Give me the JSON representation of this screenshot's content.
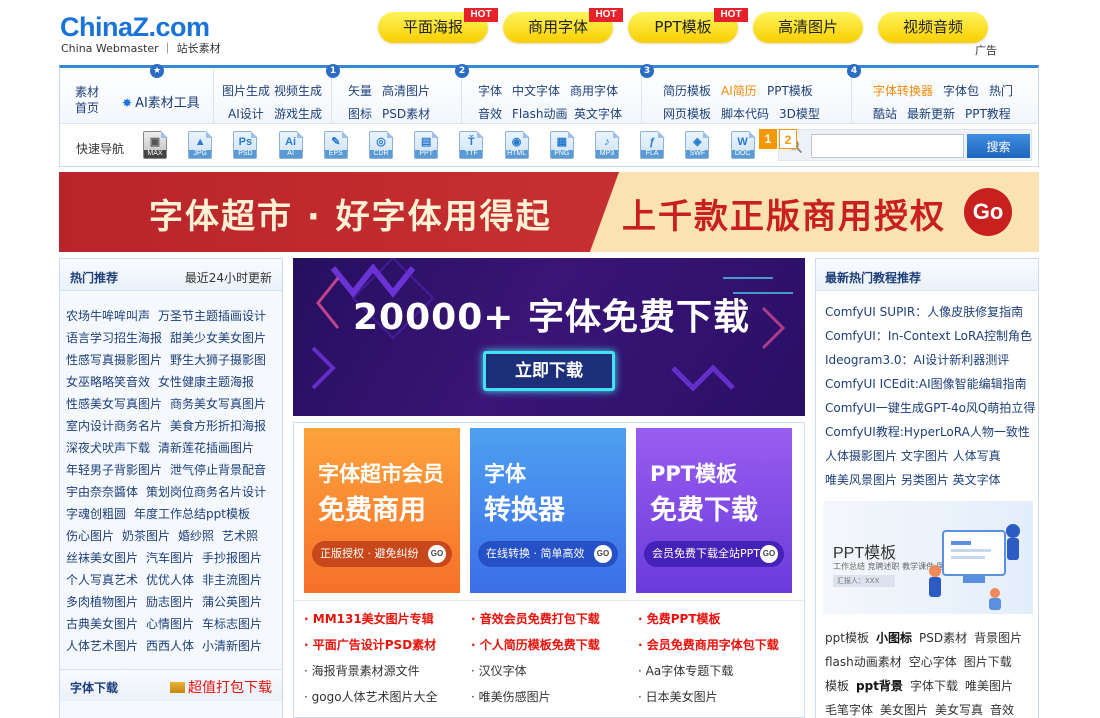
{
  "header": {
    "logo_main": "ChinaZ.com",
    "logo_sub": "China Webmaster ｜ 站长素材",
    "top_buttons": [
      {
        "label": "平面海报",
        "hot": "HOT"
      },
      {
        "label": "商用字体",
        "hot": "HOT"
      },
      {
        "label": "PPT模板",
        "hot": "HOT"
      },
      {
        "label": "高清图片",
        "hot": ""
      },
      {
        "label": "视频音频",
        "hot": ""
      }
    ],
    "ad_label": "广告"
  },
  "nav": {
    "home": "素材首页",
    "ai_tool": "AI素材工具",
    "badges": [
      "1",
      "2",
      "3",
      "4"
    ],
    "group1": [
      "图片生成",
      "视频生成",
      "AI设计",
      "游戏生成"
    ],
    "group2": [
      "矢量",
      "高清图片",
      "图标",
      "PSD素材"
    ],
    "group3": [
      "字体",
      "中文字体",
      "商用字体",
      "音效",
      "Flash动画",
      "英文字体"
    ],
    "group4": [
      "简历模板",
      "AI简历",
      "PPT模板",
      "网页模板",
      "脚本代码",
      "3D模型"
    ],
    "group5": [
      "字体转换器",
      "字体包",
      "热门",
      "酷站",
      "最新更新",
      "PPT教程"
    ],
    "quick_label": "快速导航",
    "file_icons": [
      {
        "glyph": "▣",
        "ext": "MAX",
        "icon": "max-file-icon"
      },
      {
        "glyph": "▲",
        "ext": "JPG",
        "icon": "jpg-file-icon"
      },
      {
        "glyph": "Ps",
        "ext": "PSD",
        "icon": "psd-file-icon"
      },
      {
        "glyph": "Ai",
        "ext": "AI",
        "icon": "ai-file-icon"
      },
      {
        "glyph": "✎",
        "ext": "EPS",
        "icon": "eps-file-icon"
      },
      {
        "glyph": "◎",
        "ext": "CDR",
        "icon": "cdr-file-icon"
      },
      {
        "glyph": "▤",
        "ext": "PPT",
        "icon": "ppt-file-icon"
      },
      {
        "glyph": "Ť",
        "ext": "TTF",
        "icon": "ttf-file-icon"
      },
      {
        "glyph": "◉",
        "ext": "HTML",
        "icon": "html-file-icon"
      },
      {
        "glyph": "▦",
        "ext": "PNG",
        "icon": "png-file-icon"
      },
      {
        "glyph": "♪",
        "ext": "MP3",
        "icon": "mp3-file-icon"
      },
      {
        "glyph": "ƒ",
        "ext": "FLA",
        "icon": "fla-file-icon"
      },
      {
        "glyph": "◈",
        "ext": "SWF",
        "icon": "swf-file-icon"
      },
      {
        "glyph": "W",
        "ext": "DOC",
        "icon": "doc-file-icon"
      }
    ],
    "search_value": "",
    "search_button": "搜索"
  },
  "banner": {
    "left_text": "字体超市 · 好字体用得起",
    "right_text": "上千款正版商用授权",
    "go": "Go"
  },
  "left_sidebar": {
    "title": "热门推荐",
    "note": "最近24小时更新",
    "rows": [
      [
        "农场牛哞哞叫声",
        "万圣节主题插画设计"
      ],
      [
        "语言学习招生海报",
        "甜美少女美女图片"
      ],
      [
        "性感写真摄影图片",
        "野生大狮子摄影图"
      ],
      [
        "女巫略略笑音效",
        "女性健康主题海报"
      ],
      [
        "性感美女写真图片",
        "商务美女写真图片"
      ],
      [
        "室内设计商务名片",
        "美食方形折扣海报"
      ],
      [
        "深夜犬吠声下载",
        "清新莲花插画图片"
      ],
      [
        "年轻男子背影图片",
        "泄气停止背景配音"
      ],
      [
        "宇由奈奈醬体",
        "策划岗位商务名片设计"
      ],
      [
        "字魂创粗圆",
        "年度工作总结ppt模板"
      ],
      [
        "伤心图片",
        "奶茶图片",
        "婚纱照",
        "艺术照"
      ],
      [
        "丝袜美女图片",
        "汽车图片",
        "手抄报图片"
      ],
      [
        "个人写真艺术",
        "优优人体",
        "非主流图片"
      ],
      [
        "多肉植物图片",
        "励志图片",
        "蒲公英图片"
      ],
      [
        "古典美女图片",
        "心情图片",
        "车标志图片"
      ],
      [
        "人体艺术图片",
        "西西人体",
        "小清新图片"
      ]
    ],
    "font_download_title": "字体下载",
    "font_download_link": "超值打包下载"
  },
  "slider": {
    "title": "20000+ 字体免费下载",
    "button": "立即下载",
    "pages": [
      "1",
      "2"
    ]
  },
  "promos": [
    {
      "line1": "字体超市会员",
      "line2": "免费商用",
      "tag": "正版授权 · 避免纠纷",
      "go": "GO"
    },
    {
      "line1": "字体",
      "line2": "转换器",
      "tag": "在线转换 · 简单高效",
      "go": "GO"
    },
    {
      "line1": "PPT模板",
      "line2": "免费下载",
      "tag": "会员免费下载全站PPT",
      "go": "GO"
    }
  ],
  "promo_links": [
    {
      "text": "MM131美女图片专辑",
      "red": true
    },
    {
      "text": "音效会员免费打包下载",
      "red": true
    },
    {
      "text": "免费PPT模板",
      "red": true
    },
    {
      "text": "平面广告设计PSD素材",
      "red": true
    },
    {
      "text": "个人简历模板免费下载",
      "red": true
    },
    {
      "text": "会员免费商用字体包下载",
      "red": true
    },
    {
      "text": "海报背景素材源文件",
      "red": false
    },
    {
      "text": "汉仪字体",
      "red": false
    },
    {
      "text": "Aa字体专题下载",
      "red": false
    },
    {
      "text": "gogo人体艺术图片大全",
      "red": false
    },
    {
      "text": "唯美伤感图片",
      "red": false
    },
    {
      "text": "日本美女图片",
      "red": false
    }
  ],
  "right_sidebar": {
    "title": "最新热门教程推荐",
    "links": [
      "ComfyUI SUPIR：人像皮肤修复指南",
      "ComfyUI：In-Context LoRA控制角色",
      "Ideogram3.0：AI设计新利器测评",
      "ComfyUI ICEdit:AI图像智能编辑指南",
      "ComfyUI一键生成GPT-4o风Q萌拍立得",
      "ComfyUI教程:HyperLoRA人物一致性",
      "人体摄影图片   文字图片   人体写真",
      "唯美风景图片   另类图片   英文字体"
    ],
    "image_title": "PPT模板",
    "image_sub": "工作总结  竞聘述职  教学课件  医疗保健",
    "image_reporter": "汇报人：XXX",
    "tag_rows": [
      [
        {
          "t": "ppt模板",
          "b": false
        },
        {
          "t": "小图标",
          "b": true
        },
        {
          "t": "PSD素材",
          "b": false
        },
        {
          "t": "背景图片",
          "b": false
        }
      ],
      [
        {
          "t": "flash动画素材",
          "b": false
        },
        {
          "t": "空心字体",
          "b": false
        },
        {
          "t": "图片下载",
          "b": false
        }
      ],
      [
        {
          "t": "模板",
          "b": false
        },
        {
          "t": "ppt背景",
          "b": true
        },
        {
          "t": "字体下载",
          "b": false
        },
        {
          "t": "唯美图片",
          "b": false
        }
      ],
      [
        {
          "t": "毛笔字体",
          "b": false
        },
        {
          "t": "美女图片",
          "b": false
        },
        {
          "t": "美女写真",
          "b": false
        },
        {
          "t": "音效",
          "b": false
        }
      ]
    ]
  },
  "colors": {
    "accent": "#3b86d2",
    "link": "#1f3f7a",
    "hot_red": "#e8120c",
    "orange": "#f08a0a"
  }
}
